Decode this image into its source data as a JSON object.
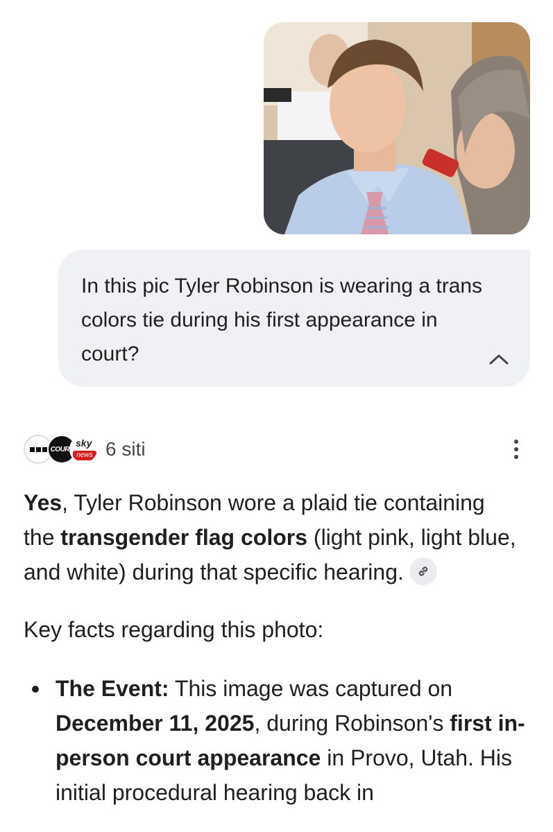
{
  "user_message": {
    "photo": {
      "subject": "man in light blue shirt with pink and blue plaid tie seated in courtroom"
    },
    "text": "In this pic Tyler Robinson is wearing a trans colors tie during his first appearance in court?"
  },
  "response": {
    "sources": {
      "count_label": "6 siti",
      "favicons": [
        "■■■",
        "COURT TV",
        "sky news"
      ]
    },
    "para1": {
      "bold1": "Yes",
      "text1": ", Tyler Robinson wore a plaid tie containing the ",
      "bold2": "transgender flag colors",
      "text2": " (light pink, light blue, and white) during that specific hearing."
    },
    "para2": "Key facts regarding this photo:",
    "facts": [
      {
        "label": "The Event:",
        "text1": " This image was captured on ",
        "bold1": "December 11, 2025",
        "text2": ", during Robinson's ",
        "bold2": "first in-person court appearance",
        "text3": " in Provo, Utah. His initial procedural hearing back in"
      }
    ]
  },
  "colors": {
    "bubble_bg": "#f0f1f5",
    "text": "#1f1f1f",
    "muted": "#444746"
  }
}
